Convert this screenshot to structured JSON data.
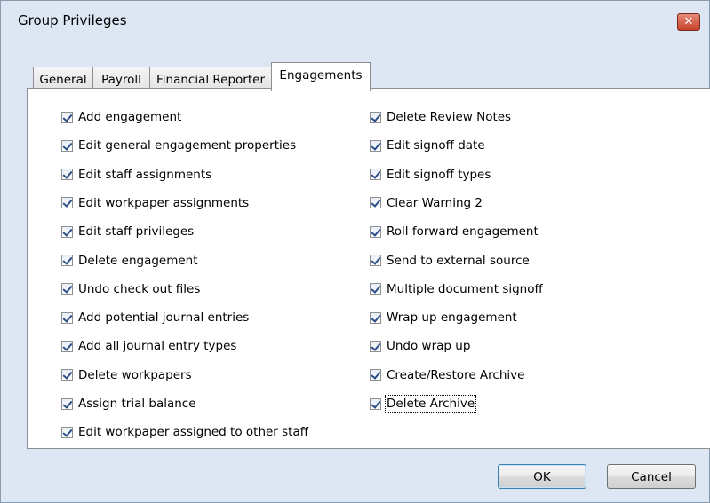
{
  "window": {
    "title": "Group Privileges",
    "close_label": "✕"
  },
  "tabs": [
    {
      "label": "General"
    },
    {
      "label": "Payroll"
    },
    {
      "label": "Financial Reporter"
    },
    {
      "label": "Engagements",
      "active": true
    }
  ],
  "left_column": [
    {
      "label": "Add engagement",
      "checked": true
    },
    {
      "label": "Edit general engagement properties",
      "checked": true
    },
    {
      "label": "Edit staff assignments",
      "checked": true
    },
    {
      "label": "Edit workpaper assignments",
      "checked": true
    },
    {
      "label": "Edit staff privileges",
      "checked": true
    },
    {
      "label": "Delete engagement",
      "checked": true
    },
    {
      "label": "Undo check out files",
      "checked": true
    },
    {
      "label": "Add potential journal entries",
      "checked": true
    },
    {
      "label": "Add all journal entry types",
      "checked": true
    },
    {
      "label": "Delete workpapers",
      "checked": true
    },
    {
      "label": "Assign trial balance",
      "checked": true
    },
    {
      "label": "Edit workpaper assigned to other staff",
      "checked": true
    }
  ],
  "right_column": [
    {
      "label": "Delete Review Notes",
      "checked": true
    },
    {
      "label": "Edit signoff date",
      "checked": true
    },
    {
      "label": "Edit signoff types",
      "checked": true
    },
    {
      "label": "Clear Warning 2",
      "checked": true
    },
    {
      "label": "Roll forward engagement",
      "checked": true
    },
    {
      "label": "Send to external source",
      "checked": true
    },
    {
      "label": "Multiple document signoff",
      "checked": true
    },
    {
      "label": "Wrap up engagement",
      "checked": true
    },
    {
      "label": "Undo wrap up",
      "checked": true
    },
    {
      "label": "Create/Restore Archive",
      "checked": true
    },
    {
      "label": "Delete Archive",
      "checked": true
    }
  ],
  "buttons": {
    "ok": "OK",
    "cancel": "Cancel"
  }
}
